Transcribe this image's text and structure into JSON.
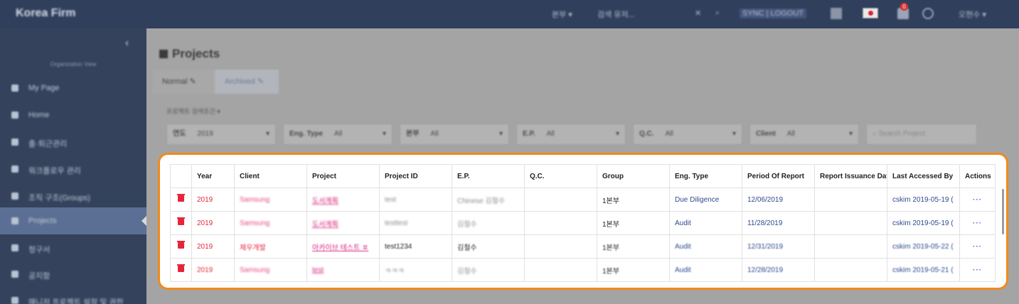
{
  "app": {
    "brand": "Korea Firm"
  },
  "topbar": {
    "items": [
      "본부 ▾",
      "검색 유저...",
      "✕",
      "⌕",
      "SYNC | LOGOUT"
    ],
    "bell_count": "0",
    "user": "오현수 ▾"
  },
  "sidebar": {
    "collapse_icon": "‹",
    "org_view": "Organization View",
    "items": [
      {
        "label": "My Page",
        "icon": "user-icon"
      },
      {
        "label": "Home",
        "icon": "home-icon"
      },
      {
        "label": "출·퇴근관리",
        "icon": "check-icon"
      },
      {
        "label": "워크플로우 관리",
        "icon": "clipboard-icon"
      },
      {
        "label": "조직 구조(Groups)",
        "icon": "org-icon"
      },
      {
        "label": "Projects",
        "icon": "project-icon"
      },
      {
        "label": "청구서",
        "icon": "invoice-icon"
      },
      {
        "label": "공지함",
        "icon": "bell-icon"
      },
      {
        "label": "매니저 프로젝트 설정 및 권한",
        "icon": "gear-icon"
      }
    ]
  },
  "main": {
    "title": "Projects",
    "tabs": [
      "Normal ✎",
      "Archived ✎"
    ],
    "filter_label": "프로젝트 검색조건 ▾",
    "filters": [
      {
        "label": "연도",
        "value": "2019"
      },
      {
        "label": "Eng. Type",
        "value": "All"
      },
      {
        "label": "본부",
        "value": "All"
      },
      {
        "label": "E.P.",
        "value": "All"
      },
      {
        "label": "Q.C.",
        "value": "All"
      },
      {
        "label": "Client",
        "value": "All"
      }
    ],
    "search_placeholder": "Search Project"
  },
  "table": {
    "headers": [
      "",
      "Year",
      "Client",
      "Project",
      "Project ID",
      "E.P.",
      "Q.C.",
      "Group",
      "Eng. Type",
      "Period Of Report",
      "Report Issuance Date",
      "Last Accessed By",
      "Actions"
    ],
    "rows": [
      {
        "year": "2019",
        "client": "Samsung",
        "project": "도서계획",
        "project_id": "test",
        "ep": "Chinese 김철수",
        "qc": "",
        "group": "1본부",
        "eng_type": "Due Diligence",
        "period": "12/06/2019",
        "issuance": "",
        "last_accessed": "cskim 2019-05-19 (",
        "actions": "···"
      },
      {
        "year": "2019",
        "client": "Samsung",
        "project": "도서계획",
        "project_id": "testtest",
        "ep": "김철수",
        "qc": "",
        "group": "1본부",
        "eng_type": "Audit",
        "period": "11/28/2019",
        "issuance": "",
        "last_accessed": "cskim 2019-05-19 (",
        "actions": "···"
      },
      {
        "year": "2019",
        "client": "제우개발",
        "project": "아카이브 테스트 ㅍ",
        "project_id": "test1234",
        "ep": "김철수",
        "qc": "",
        "group": "1본부",
        "eng_type": "Audit",
        "period": "12/31/2019",
        "issuance": "",
        "last_accessed": "cskim 2019-05-22 (",
        "actions": "···"
      },
      {
        "year": "2019",
        "client": "Samsung",
        "project": "test",
        "project_id": "ㅋㅋㅋ",
        "ep": "김철수",
        "qc": "",
        "group": "1본부",
        "eng_type": "Audit",
        "period": "12/28/2019",
        "issuance": "",
        "last_accessed": "cskim 2019-05-21 (",
        "actions": "···"
      }
    ]
  },
  "colors": {
    "highlight_border": "#f08a1c",
    "topbar": "#2f3f5c",
    "sidebar": "#34425c",
    "accent_red": "#e12a3e"
  }
}
